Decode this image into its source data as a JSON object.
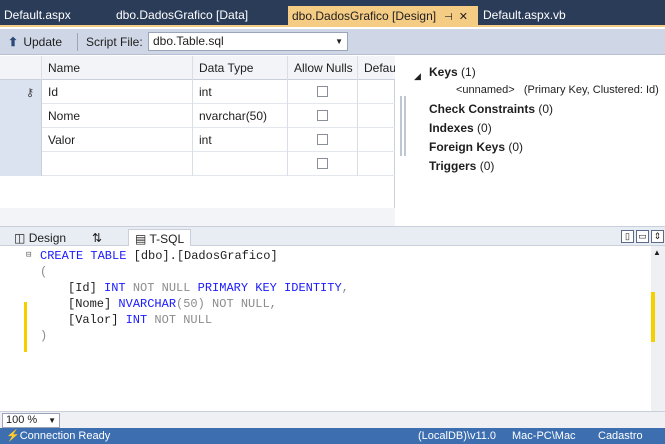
{
  "tabs": [
    {
      "label": "Default.aspx"
    },
    {
      "label": "dbo.DadosGrafico [Data]"
    },
    {
      "label": "dbo.DadosGrafico [Design]"
    },
    {
      "label": "Default.aspx.vb"
    }
  ],
  "toolbar": {
    "update_label": "Update",
    "script_file_label": "Script File:",
    "script_file_value": "dbo.Table.sql"
  },
  "grid": {
    "columns": [
      "Name",
      "Data Type",
      "Allow Nulls",
      "Default"
    ],
    "rows": [
      {
        "name": "Id",
        "type": "int",
        "allow_nulls": false,
        "is_key": true
      },
      {
        "name": "Nome",
        "type": "nvarchar(50)",
        "allow_nulls": false,
        "is_key": false
      },
      {
        "name": "Valor",
        "type": "int",
        "allow_nulls": false,
        "is_key": false
      },
      {
        "name": "",
        "type": "",
        "allow_nulls": false,
        "is_key": false
      }
    ]
  },
  "properties": {
    "keys_label": "Keys",
    "keys_count": "(1)",
    "key_name": "<unnamed>",
    "key_desc": "(Primary Key, Clustered: Id)",
    "check_label": "Check Constraints",
    "check_count": "(0)",
    "indexes_label": "Indexes",
    "indexes_count": "(0)",
    "fk_label": "Foreign Keys",
    "fk_count": "(0)",
    "triggers_label": "Triggers",
    "triggers_count": "(0)"
  },
  "pane_tabs": {
    "design": "Design",
    "swap": "⇅",
    "tsql": "T-SQL"
  },
  "code": {
    "line1_kw": "CREATE TABLE",
    "line1_rest": " [dbo].[DadosGrafico]",
    "line2": "(",
    "line3_a": "[Id] ",
    "line3_b": "INT",
    "line3_c": " NOT NULL ",
    "line3_d": "PRIMARY KEY IDENTITY",
    "line3_e": ",",
    "line4_a": "[Nome] ",
    "line4_b": "NVARCHAR",
    "line4_c": "(50)",
    "line4_d": " NOT NULL",
    "line4_e": ",",
    "line5_a": "[Valor] ",
    "line5_b": "INT",
    "line5_c": " NOT NULL",
    "line6": ")"
  },
  "zoom": "100 %",
  "status": {
    "connection": "Connection Ready",
    "server": "(LocalDB)\\v11.0",
    "user": "Mac-PC\\Mac",
    "db": "Cadastro"
  },
  "colors": {
    "tab_bg": "#2b3c59",
    "active_tab": "#f5cc84",
    "status_bg": "#3d6fb0",
    "keyword": "#1a1aff"
  }
}
